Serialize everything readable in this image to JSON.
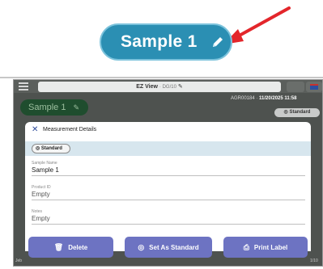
{
  "callout": {
    "label": "Sample 1",
    "pill_color": "#2b8fb3",
    "arrow_color": "#e3262b",
    "icon": "pencil-icon"
  },
  "app": {
    "title": "EZ View",
    "version": "· DG/10",
    "title_icon": "pencil-icon",
    "sample_chip": "Sample 1",
    "instrument_id": "AGR00184 ·",
    "datetime": "11/20/2025 11:58",
    "standard_badge": "Standard",
    "bottom_left": "Jeb",
    "bottom_right": "1/10"
  },
  "modal": {
    "title": "Measurement Details",
    "standard_pill": "Standard",
    "fields": [
      {
        "label": "Sample Name",
        "value": "Sample 1"
      },
      {
        "label": "Product ID",
        "value": "Empty"
      },
      {
        "label": "Notes",
        "value": "Empty"
      }
    ]
  },
  "actions": {
    "delete": "Delete",
    "set_standard": "Set As Standard",
    "print_label": "Print Label",
    "accent": "#6d73c2"
  }
}
